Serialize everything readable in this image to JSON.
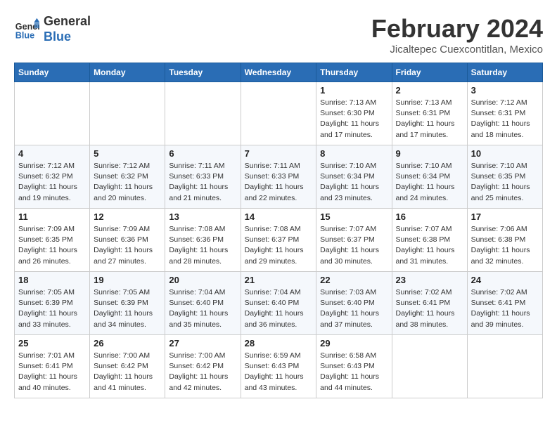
{
  "header": {
    "logo_line1": "General",
    "logo_line2": "Blue",
    "month_year": "February 2024",
    "location": "Jicaltepec Cuexcontitlan, Mexico"
  },
  "weekdays": [
    "Sunday",
    "Monday",
    "Tuesday",
    "Wednesday",
    "Thursday",
    "Friday",
    "Saturday"
  ],
  "weeks": [
    [
      {
        "day": "",
        "sunrise": "",
        "sunset": "",
        "daylight": ""
      },
      {
        "day": "",
        "sunrise": "",
        "sunset": "",
        "daylight": ""
      },
      {
        "day": "",
        "sunrise": "",
        "sunset": "",
        "daylight": ""
      },
      {
        "day": "",
        "sunrise": "",
        "sunset": "",
        "daylight": ""
      },
      {
        "day": "1",
        "sunrise": "Sunrise: 7:13 AM",
        "sunset": "Sunset: 6:30 PM",
        "daylight": "Daylight: 11 hours and 17 minutes."
      },
      {
        "day": "2",
        "sunrise": "Sunrise: 7:13 AM",
        "sunset": "Sunset: 6:31 PM",
        "daylight": "Daylight: 11 hours and 17 minutes."
      },
      {
        "day": "3",
        "sunrise": "Sunrise: 7:12 AM",
        "sunset": "Sunset: 6:31 PM",
        "daylight": "Daylight: 11 hours and 18 minutes."
      }
    ],
    [
      {
        "day": "4",
        "sunrise": "Sunrise: 7:12 AM",
        "sunset": "Sunset: 6:32 PM",
        "daylight": "Daylight: 11 hours and 19 minutes."
      },
      {
        "day": "5",
        "sunrise": "Sunrise: 7:12 AM",
        "sunset": "Sunset: 6:32 PM",
        "daylight": "Daylight: 11 hours and 20 minutes."
      },
      {
        "day": "6",
        "sunrise": "Sunrise: 7:11 AM",
        "sunset": "Sunset: 6:33 PM",
        "daylight": "Daylight: 11 hours and 21 minutes."
      },
      {
        "day": "7",
        "sunrise": "Sunrise: 7:11 AM",
        "sunset": "Sunset: 6:33 PM",
        "daylight": "Daylight: 11 hours and 22 minutes."
      },
      {
        "day": "8",
        "sunrise": "Sunrise: 7:10 AM",
        "sunset": "Sunset: 6:34 PM",
        "daylight": "Daylight: 11 hours and 23 minutes."
      },
      {
        "day": "9",
        "sunrise": "Sunrise: 7:10 AM",
        "sunset": "Sunset: 6:34 PM",
        "daylight": "Daylight: 11 hours and 24 minutes."
      },
      {
        "day": "10",
        "sunrise": "Sunrise: 7:10 AM",
        "sunset": "Sunset: 6:35 PM",
        "daylight": "Daylight: 11 hours and 25 minutes."
      }
    ],
    [
      {
        "day": "11",
        "sunrise": "Sunrise: 7:09 AM",
        "sunset": "Sunset: 6:35 PM",
        "daylight": "Daylight: 11 hours and 26 minutes."
      },
      {
        "day": "12",
        "sunrise": "Sunrise: 7:09 AM",
        "sunset": "Sunset: 6:36 PM",
        "daylight": "Daylight: 11 hours and 27 minutes."
      },
      {
        "day": "13",
        "sunrise": "Sunrise: 7:08 AM",
        "sunset": "Sunset: 6:36 PM",
        "daylight": "Daylight: 11 hours and 28 minutes."
      },
      {
        "day": "14",
        "sunrise": "Sunrise: 7:08 AM",
        "sunset": "Sunset: 6:37 PM",
        "daylight": "Daylight: 11 hours and 29 minutes."
      },
      {
        "day": "15",
        "sunrise": "Sunrise: 7:07 AM",
        "sunset": "Sunset: 6:37 PM",
        "daylight": "Daylight: 11 hours and 30 minutes."
      },
      {
        "day": "16",
        "sunrise": "Sunrise: 7:07 AM",
        "sunset": "Sunset: 6:38 PM",
        "daylight": "Daylight: 11 hours and 31 minutes."
      },
      {
        "day": "17",
        "sunrise": "Sunrise: 7:06 AM",
        "sunset": "Sunset: 6:38 PM",
        "daylight": "Daylight: 11 hours and 32 minutes."
      }
    ],
    [
      {
        "day": "18",
        "sunrise": "Sunrise: 7:05 AM",
        "sunset": "Sunset: 6:39 PM",
        "daylight": "Daylight: 11 hours and 33 minutes."
      },
      {
        "day": "19",
        "sunrise": "Sunrise: 7:05 AM",
        "sunset": "Sunset: 6:39 PM",
        "daylight": "Daylight: 11 hours and 34 minutes."
      },
      {
        "day": "20",
        "sunrise": "Sunrise: 7:04 AM",
        "sunset": "Sunset: 6:40 PM",
        "daylight": "Daylight: 11 hours and 35 minutes."
      },
      {
        "day": "21",
        "sunrise": "Sunrise: 7:04 AM",
        "sunset": "Sunset: 6:40 PM",
        "daylight": "Daylight: 11 hours and 36 minutes."
      },
      {
        "day": "22",
        "sunrise": "Sunrise: 7:03 AM",
        "sunset": "Sunset: 6:40 PM",
        "daylight": "Daylight: 11 hours and 37 minutes."
      },
      {
        "day": "23",
        "sunrise": "Sunrise: 7:02 AM",
        "sunset": "Sunset: 6:41 PM",
        "daylight": "Daylight: 11 hours and 38 minutes."
      },
      {
        "day": "24",
        "sunrise": "Sunrise: 7:02 AM",
        "sunset": "Sunset: 6:41 PM",
        "daylight": "Daylight: 11 hours and 39 minutes."
      }
    ],
    [
      {
        "day": "25",
        "sunrise": "Sunrise: 7:01 AM",
        "sunset": "Sunset: 6:41 PM",
        "daylight": "Daylight: 11 hours and 40 minutes."
      },
      {
        "day": "26",
        "sunrise": "Sunrise: 7:00 AM",
        "sunset": "Sunset: 6:42 PM",
        "daylight": "Daylight: 11 hours and 41 minutes."
      },
      {
        "day": "27",
        "sunrise": "Sunrise: 7:00 AM",
        "sunset": "Sunset: 6:42 PM",
        "daylight": "Daylight: 11 hours and 42 minutes."
      },
      {
        "day": "28",
        "sunrise": "Sunrise: 6:59 AM",
        "sunset": "Sunset: 6:43 PM",
        "daylight": "Daylight: 11 hours and 43 minutes."
      },
      {
        "day": "29",
        "sunrise": "Sunrise: 6:58 AM",
        "sunset": "Sunset: 6:43 PM",
        "daylight": "Daylight: 11 hours and 44 minutes."
      },
      {
        "day": "",
        "sunrise": "",
        "sunset": "",
        "daylight": ""
      },
      {
        "day": "",
        "sunrise": "",
        "sunset": "",
        "daylight": ""
      }
    ]
  ]
}
